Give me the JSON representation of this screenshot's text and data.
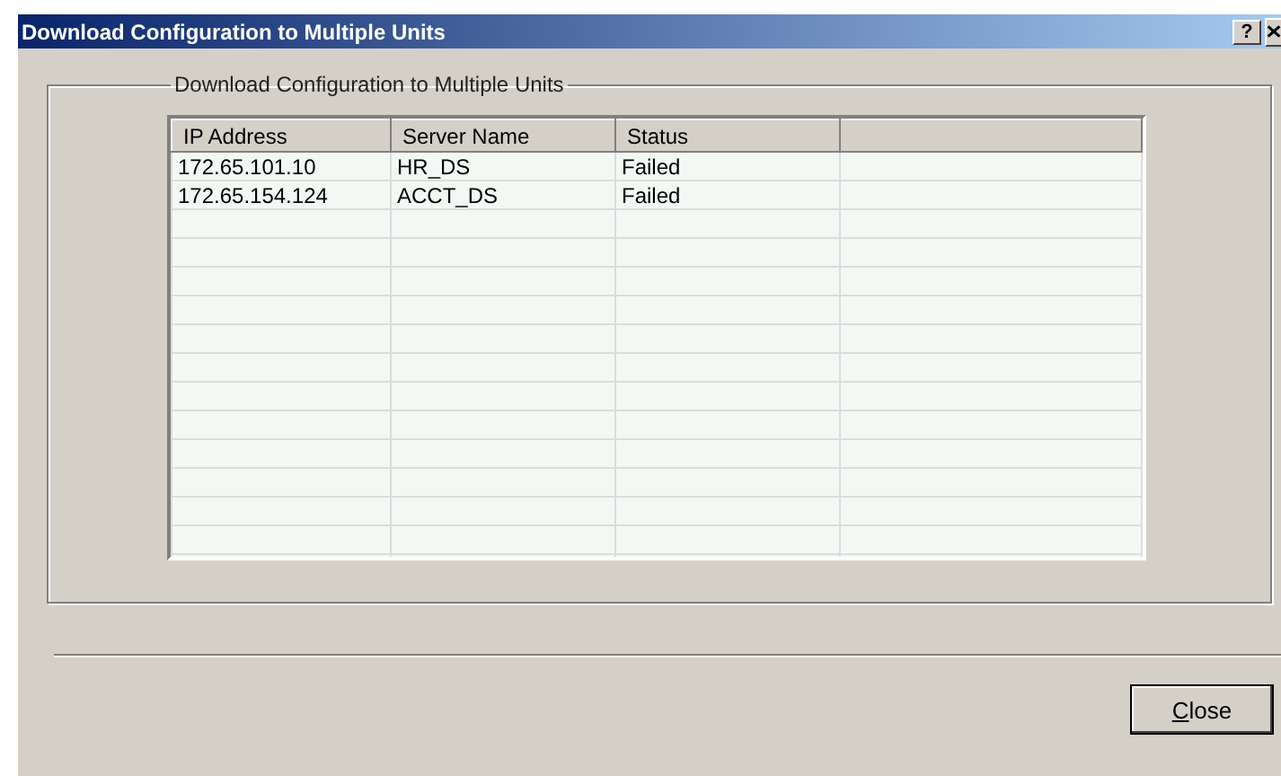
{
  "window": {
    "title": "Download Configuration to Multiple Units",
    "help_button": "?"
  },
  "group": {
    "label": "Download Configuration to Multiple Units"
  },
  "table": {
    "columns": [
      "IP Address",
      "Server Name",
      "Status"
    ],
    "rows": [
      [
        "172.65.101.10",
        "HR_DS",
        "Failed"
      ],
      [
        "172.65.154.124",
        "ACCT_DS",
        "Failed"
      ]
    ]
  },
  "buttons": [
    {
      "label": "Close",
      "access_key_underlined": true
    }
  ]
}
